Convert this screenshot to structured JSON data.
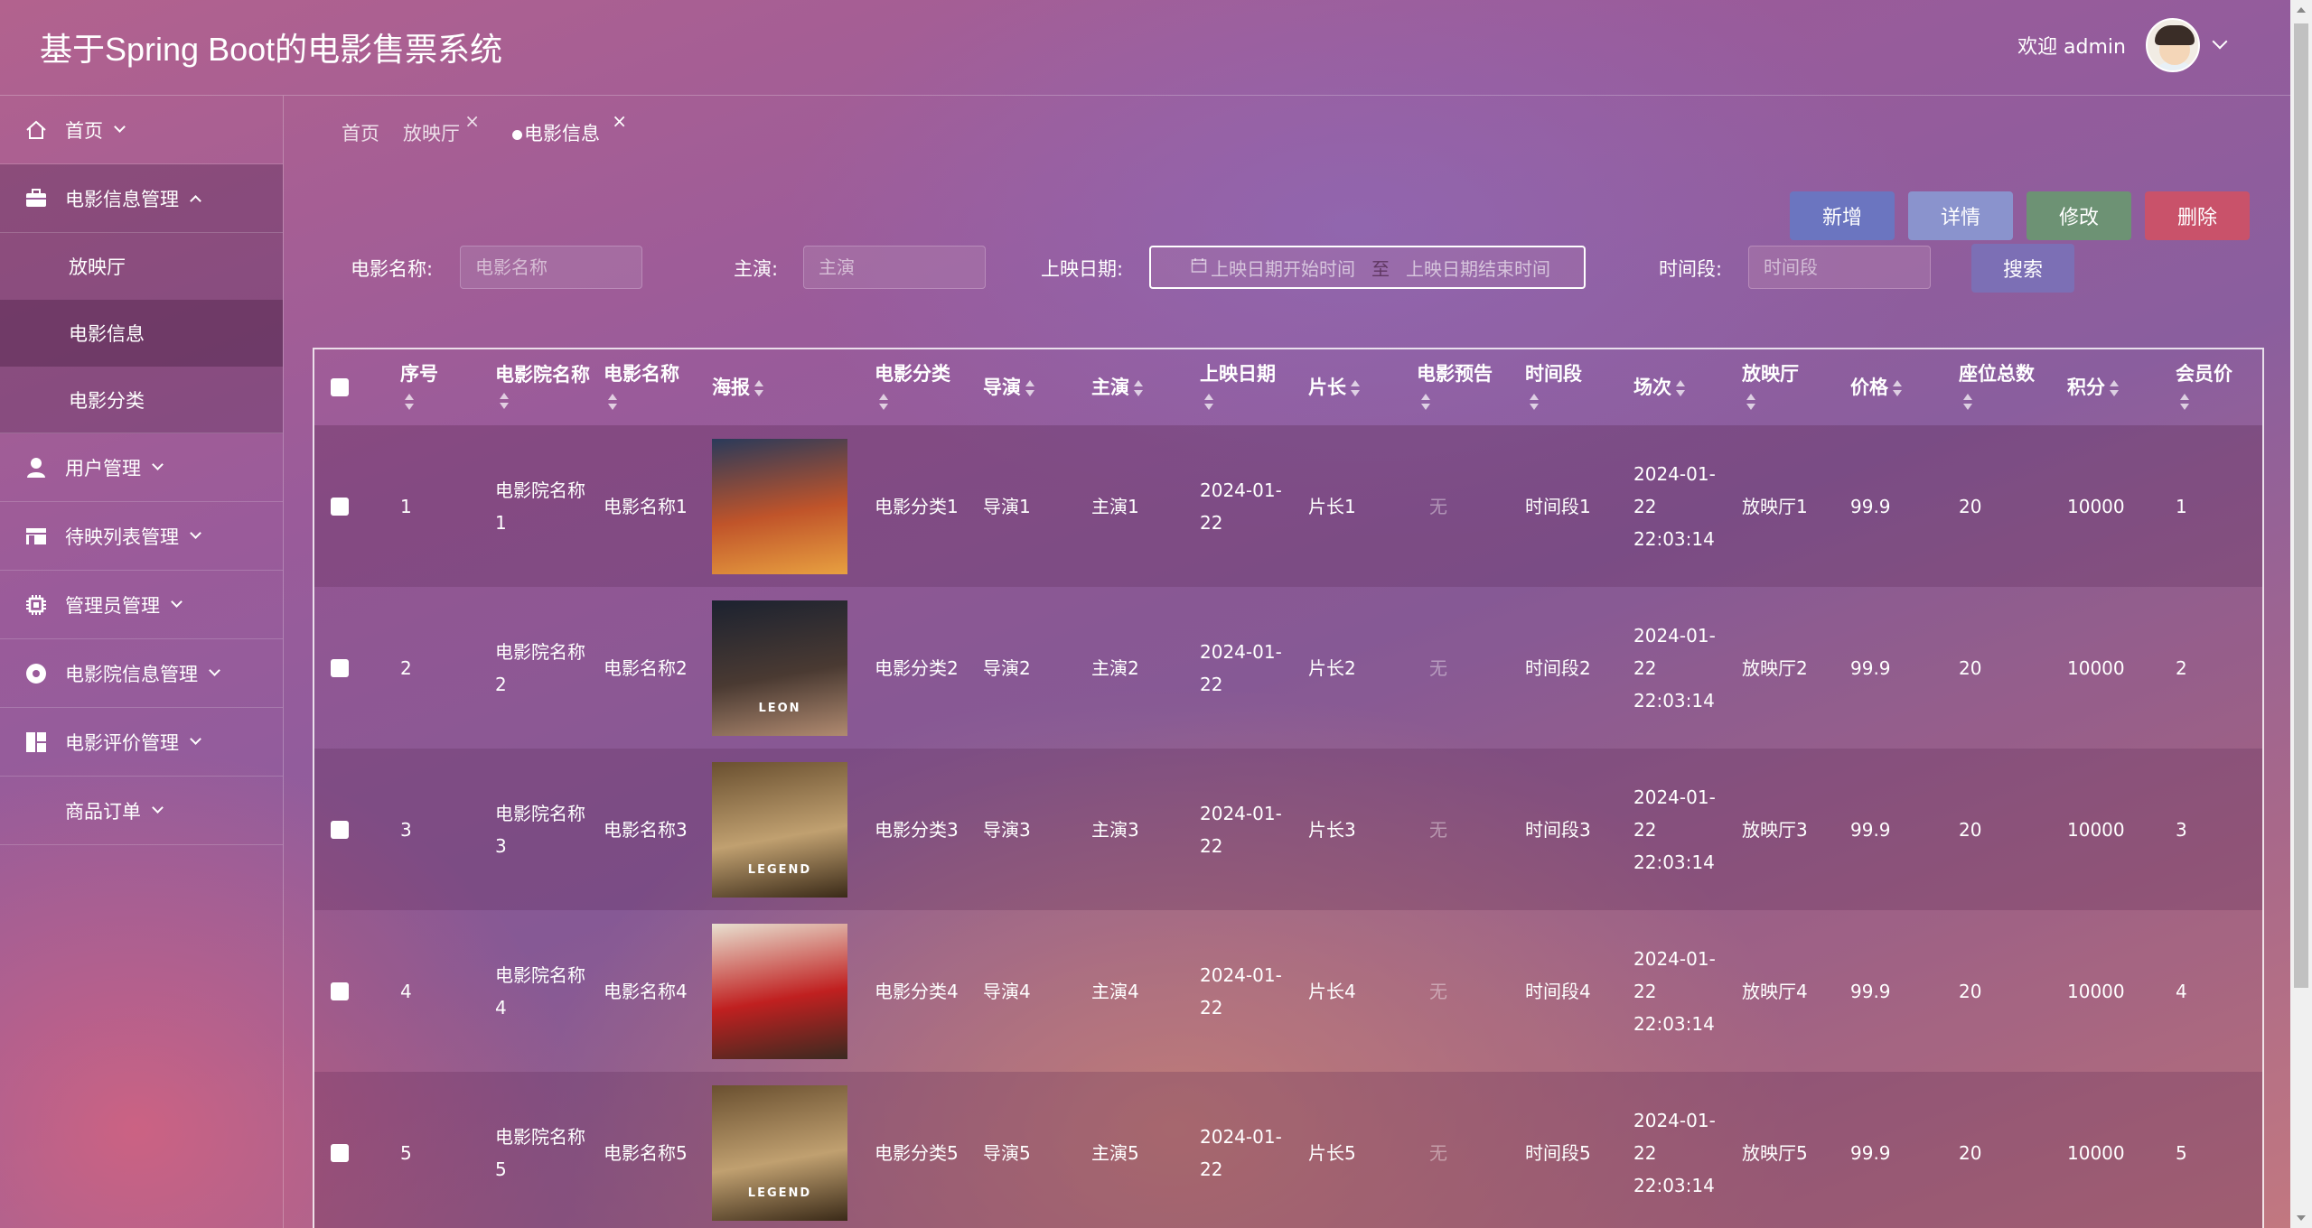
{
  "header": {
    "title": "基于Spring Boot的电影售票系统",
    "welcome": "欢迎 admin"
  },
  "sidebar": {
    "items": [
      {
        "label": "首页",
        "icon": "home-icon"
      },
      {
        "label": "电影信息管理",
        "icon": "briefcase-icon",
        "open": true,
        "children": [
          {
            "label": "放映厅"
          },
          {
            "label": "电影信息",
            "active": true
          },
          {
            "label": "电影分类"
          }
        ]
      },
      {
        "label": "用户管理",
        "icon": "user-icon"
      },
      {
        "label": "待映列表管理",
        "icon": "store-icon"
      },
      {
        "label": "管理员管理",
        "icon": "chip-icon"
      },
      {
        "label": "电影院信息管理",
        "icon": "record-icon"
      },
      {
        "label": "电影评价管理",
        "icon": "dashboard-icon"
      },
      {
        "label": "商品订单",
        "icon": ""
      }
    ]
  },
  "tabs": [
    {
      "label": "首页",
      "closable": false
    },
    {
      "label": "放映厅",
      "closable": true
    },
    {
      "label": "电影信息",
      "closable": true,
      "active": true
    }
  ],
  "actions": {
    "add": "新增",
    "detail": "详情",
    "edit": "修改",
    "delete": "删除"
  },
  "search": {
    "movie_name_label": "电影名称:",
    "movie_name_placeholder": "电影名称",
    "actor_label": "主演:",
    "actor_placeholder": "主演",
    "date_label": "上映日期:",
    "date_start_placeholder": "上映日期开始时间",
    "date_sep": "至",
    "date_end_placeholder": "上映日期结束时间",
    "period_label": "时间段:",
    "period_placeholder": "时间段",
    "search_button": "搜索"
  },
  "table": {
    "columns": [
      "序号",
      "电影院名称",
      "电影名称",
      "海报",
      "电影分类",
      "导演",
      "主演",
      "上映日期",
      "片长",
      "电影预告",
      "时间段",
      "场次",
      "放映厅",
      "价格",
      "座位总数",
      "积分",
      "会员价"
    ],
    "rows": [
      {
        "no": "1",
        "cinema": "电影院名称1",
        "movie": "电影名称1",
        "category": "电影分类1",
        "director": "导演1",
        "actor": "主演1",
        "date": "2024-01-22",
        "length": "片长1",
        "trailer": "无",
        "period": "时间段1",
        "session": "2024-01-22 22:03:14",
        "hall": "放映厅1",
        "price": "99.9",
        "seats": "20",
        "points": "10000",
        "member_price": "1"
      },
      {
        "no": "2",
        "cinema": "电影院名称2",
        "movie": "电影名称2",
        "category": "电影分类2",
        "director": "导演2",
        "actor": "主演2",
        "date": "2024-01-22",
        "length": "片长2",
        "trailer": "无",
        "period": "时间段2",
        "session": "2024-01-22 22:03:14",
        "hall": "放映厅2",
        "price": "99.9",
        "seats": "20",
        "points": "10000",
        "member_price": "2"
      },
      {
        "no": "3",
        "cinema": "电影院名称3",
        "movie": "电影名称3",
        "category": "电影分类3",
        "director": "导演3",
        "actor": "主演3",
        "date": "2024-01-22",
        "length": "片长3",
        "trailer": "无",
        "period": "时间段3",
        "session": "2024-01-22 22:03:14",
        "hall": "放映厅3",
        "price": "99.9",
        "seats": "20",
        "points": "10000",
        "member_price": "3"
      },
      {
        "no": "4",
        "cinema": "电影院名称4",
        "movie": "电影名称4",
        "category": "电影分类4",
        "director": "导演4",
        "actor": "主演4",
        "date": "2024-01-22",
        "length": "片长4",
        "trailer": "无",
        "period": "时间段4",
        "session": "2024-01-22 22:03:14",
        "hall": "放映厅4",
        "price": "99.9",
        "seats": "20",
        "points": "10000",
        "member_price": "4"
      },
      {
        "no": "5",
        "cinema": "电影院名称5",
        "movie": "电影名称5",
        "category": "电影分类5",
        "director": "导演5",
        "actor": "主演5",
        "date": "2024-01-22",
        "length": "片长5",
        "trailer": "无",
        "period": "时间段5",
        "session": "2024-01-22 22:03:14",
        "hall": "放映厅5",
        "price": "99.9",
        "seats": "20",
        "points": "10000",
        "member_price": "5"
      }
    ]
  },
  "posters": [
    {
      "title": "",
      "colors": [
        "#2a3a5a",
        "#c0542a",
        "#e8a040"
      ]
    },
    {
      "title": "LEON",
      "colors": [
        "#1c2230",
        "#4a3a32",
        "#b08a70"
      ]
    },
    {
      "title": "LEGEND",
      "colors": [
        "#6a5030",
        "#c0a070",
        "#3a2a18"
      ]
    },
    {
      "title": "",
      "colors": [
        "#e8e0d0",
        "#c02020",
        "#3a2a20"
      ]
    },
    {
      "title": "LEGEND",
      "colors": [
        "#6a5030",
        "#c0a070",
        "#3a2a18"
      ]
    }
  ],
  "colors": {
    "add": "#6b75c0",
    "detail": "#8a93cd",
    "edit": "#6d9274",
    "delete": "#c9526a",
    "search": "#7c6fb5"
  }
}
